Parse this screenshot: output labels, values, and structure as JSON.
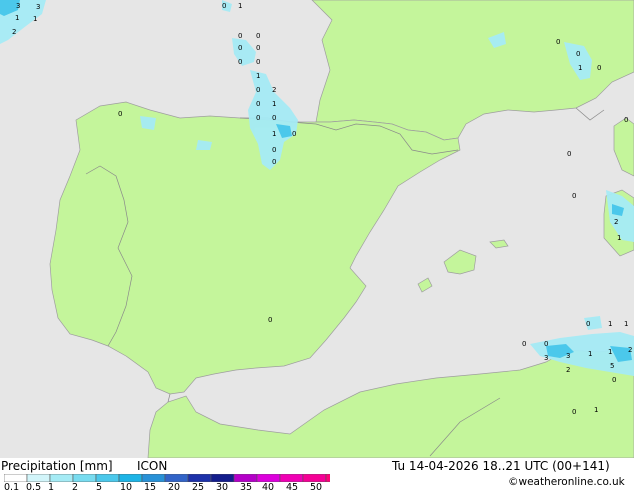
{
  "title": "Precipitation [mm]",
  "model": "ICON",
  "valid_time": "Tu 14-04-2026 18..21 UTC (00+141)",
  "credit": "©weatheronline.co.uk",
  "legend": {
    "ticks": [
      "0.1",
      "0.5",
      "1",
      "2",
      "5",
      "10",
      "15",
      "20",
      "25",
      "30",
      "35",
      "40",
      "45",
      "50"
    ],
    "colors": [
      "#ffffff",
      "#d2f5fa",
      "#a5ebf5",
      "#78dcf0",
      "#4bc8eb",
      "#1eb4e6",
      "#2891d7",
      "#3264c8",
      "#1e32aa",
      "#141e8c",
      "#b400c8",
      "#dc00dc",
      "#f000b4",
      "#f50096",
      "#ff0078"
    ]
  },
  "colors": {
    "sea": "#e6e6e6",
    "land": "#c4f59b",
    "border": "#8a8a8a",
    "coast": "#9e9e9e"
  },
  "values": [
    "3",
    "3",
    "1",
    "1",
    "2",
    "0",
    "1",
    "0",
    "0",
    "0",
    "0",
    "0",
    "0",
    "1",
    "0",
    "2",
    "0",
    "1",
    "0",
    "0",
    "0",
    "0",
    "0",
    "1",
    "0",
    "0",
    "1",
    "0",
    "2",
    "1",
    "0",
    "0",
    "0",
    "0",
    "0",
    "0",
    "1",
    "1",
    "0",
    "0",
    "3",
    "1",
    "2",
    "1",
    "2",
    "3",
    "5",
    "0",
    "0",
    "1"
  ]
}
